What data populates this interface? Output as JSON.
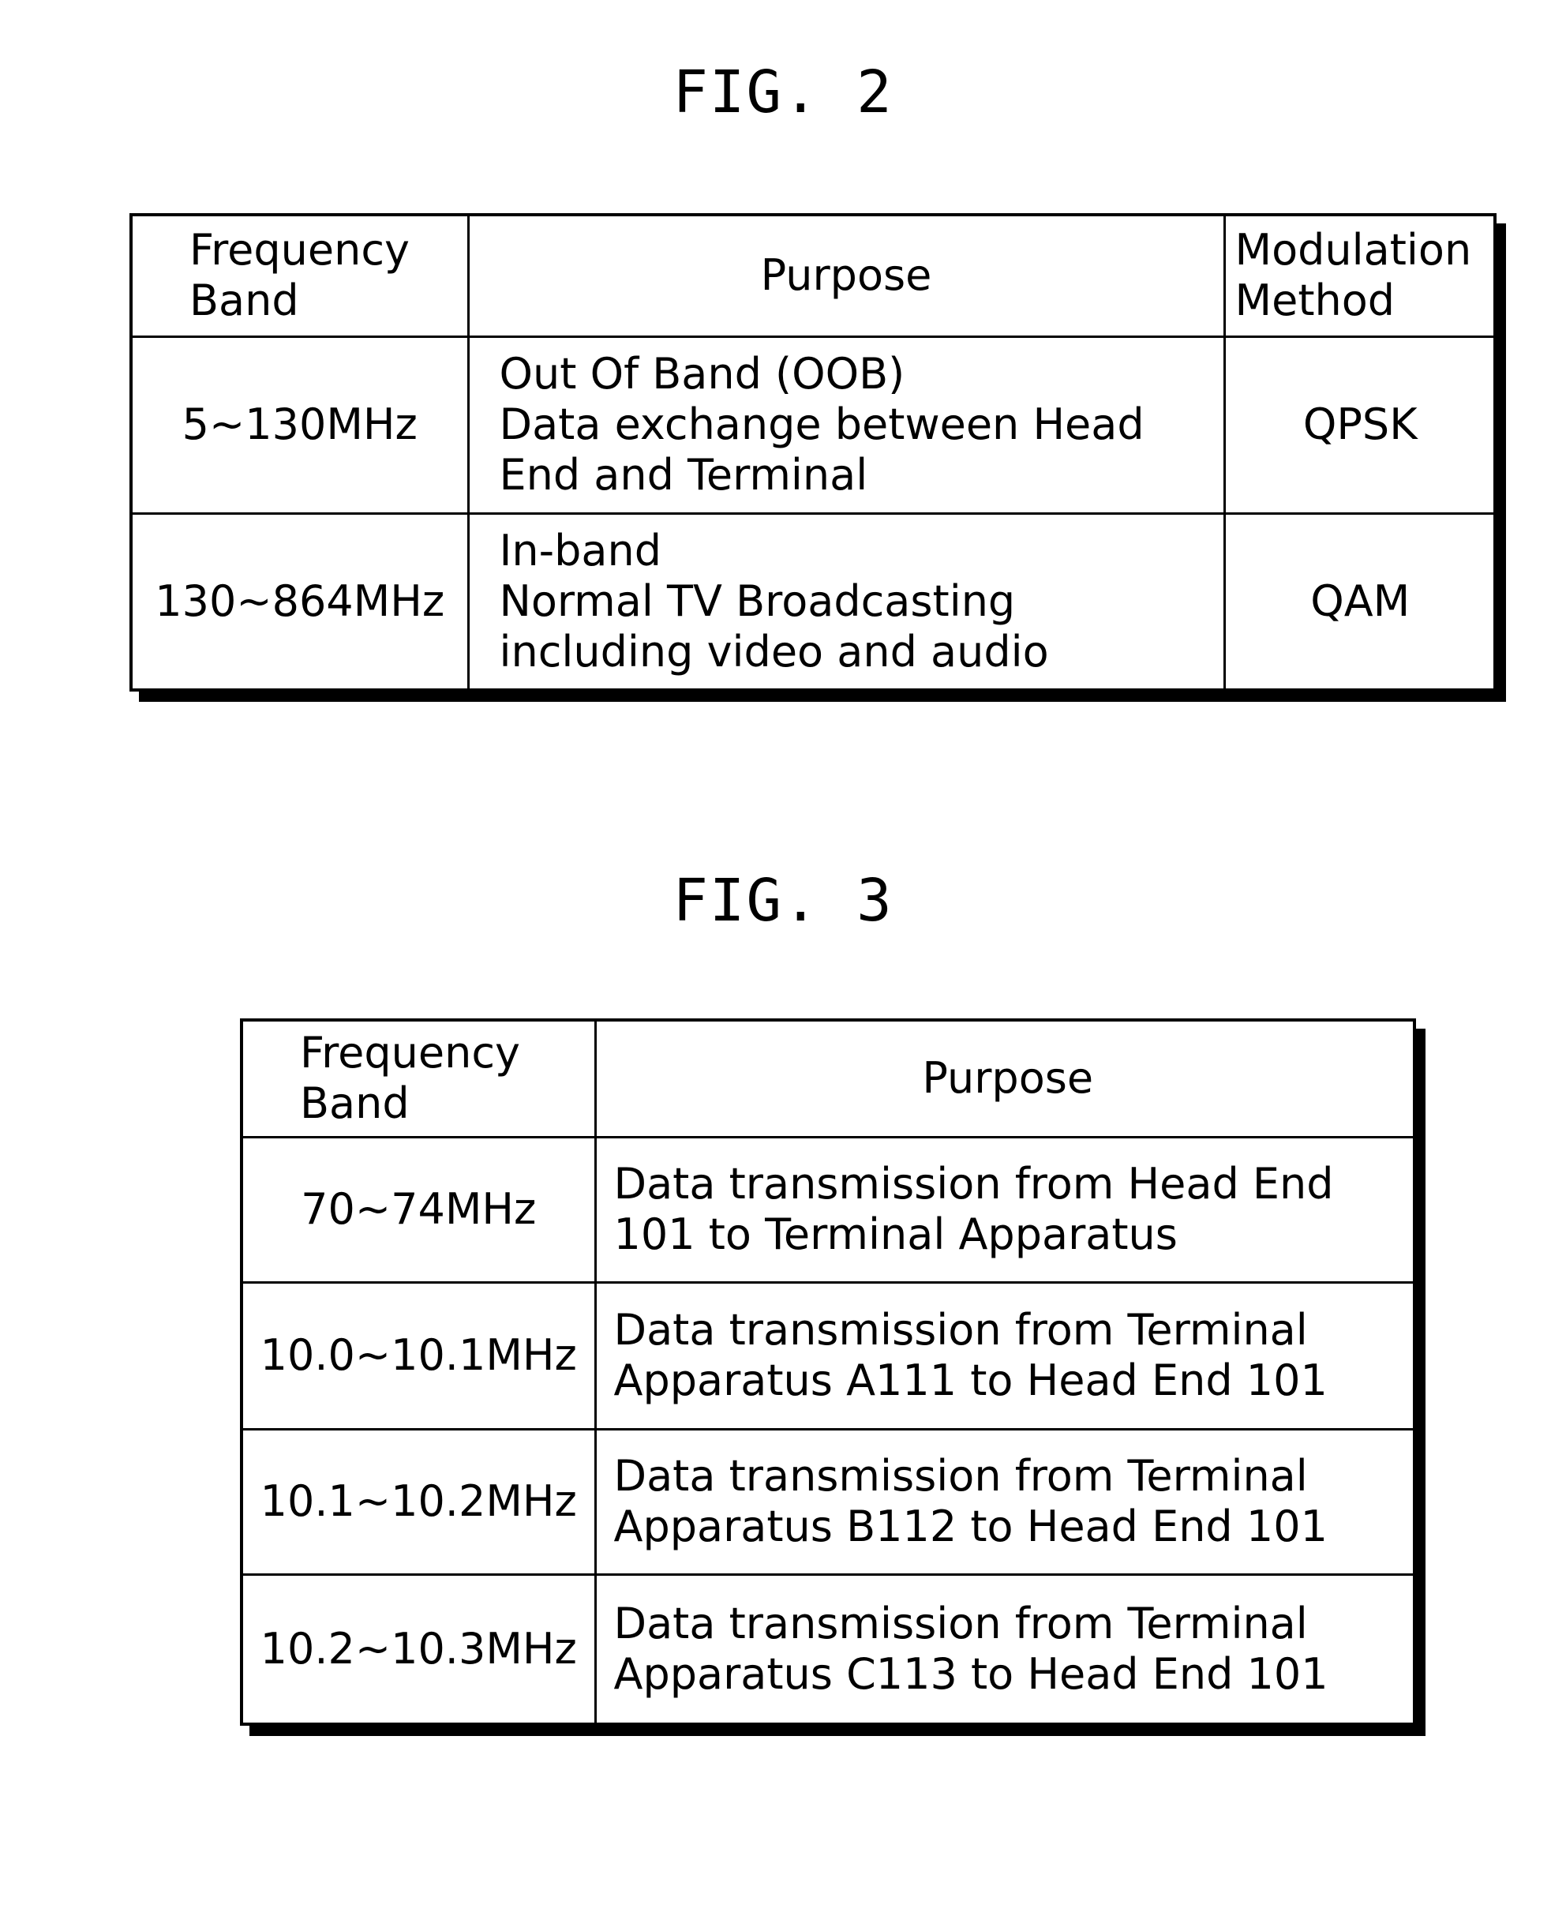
{
  "fig2": {
    "title": "FIG. 2",
    "headers": {
      "band": [
        "Frequency",
        "Band"
      ],
      "purpose": "Purpose",
      "modulation": [
        "Modulation",
        "Method"
      ]
    },
    "rows": [
      {
        "band": "5~130MHz",
        "purpose": [
          "Out Of Band (OOB)",
          "Data exchange between Head",
          "End and Terminal"
        ],
        "modulation": "QPSK"
      },
      {
        "band": "130~864MHz",
        "purpose": [
          "In-band",
          "Normal TV Broadcasting",
          "including video and audio"
        ],
        "modulation": "QAM"
      }
    ]
  },
  "fig3": {
    "title": "FIG. 3",
    "headers": {
      "band": [
        "Frequency",
        "Band"
      ],
      "purpose": "Purpose"
    },
    "rows": [
      {
        "band": "70~74MHz",
        "purpose": [
          "Data transmission from Head End",
          "101 to Terminal Apparatus"
        ]
      },
      {
        "band": "10.0~10.1MHz",
        "purpose": [
          "Data transmission from Terminal",
          "Apparatus A111 to Head End 101"
        ]
      },
      {
        "band": "10.1~10.2MHz",
        "purpose": [
          "Data transmission from Terminal",
          "Apparatus B112 to Head End 101"
        ]
      },
      {
        "band": "10.2~10.3MHz",
        "purpose": [
          "Data transmission from Terminal",
          "Apparatus C113 to Head End 101"
        ]
      }
    ]
  }
}
